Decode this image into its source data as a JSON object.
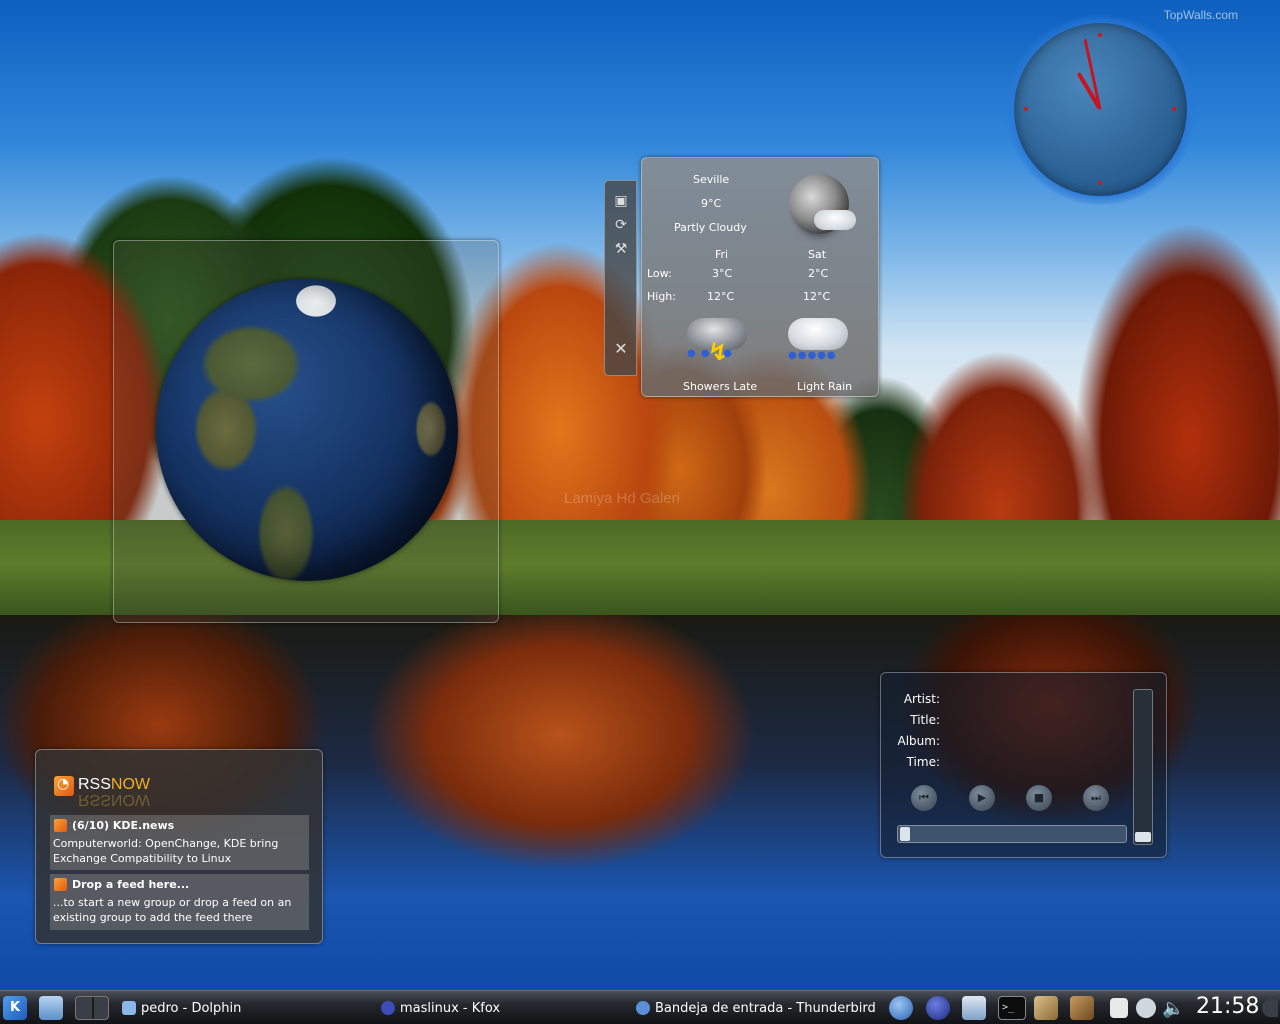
{
  "desktop": {
    "watermark_corner": "TopWalls.com",
    "watermark_center": "Lamiya Hd Galeri"
  },
  "weather": {
    "city": "Seville",
    "temperature": "9°C",
    "condition": "Partly Cloudy",
    "low_label": "Low:",
    "high_label": "High:",
    "days": [
      {
        "name": "Fri",
        "low": "3°C",
        "high": "12°C",
        "forecast": "Showers Late",
        "icon": "thunder-rain-icon"
      },
      {
        "name": "Sat",
        "low": "2°C",
        "high": "12°C",
        "forecast": "Light Rain",
        "icon": "light-rain-icon"
      }
    ],
    "handle_icons": [
      "image-icon",
      "refresh-icon",
      "wrench-icon",
      "close-icon"
    ]
  },
  "clock": {
    "hour": 10,
    "minute": 58
  },
  "rss": {
    "brand_part1": "RSS",
    "brand_part2": "NOW",
    "feeds": [
      {
        "title": "(6/10) KDE.news",
        "text": "Computerworld: OpenChange, KDE bring Exchange Compatibility to Linux"
      },
      {
        "title": "Drop a feed here...",
        "text": "...to start a new group or drop a feed on an existing group to add the feed there"
      }
    ]
  },
  "player": {
    "artist_label": "Artist:",
    "title_label": "Title:",
    "album_label": "Album:",
    "time_label": "Time:",
    "buttons": [
      "previous-icon",
      "play-icon",
      "stop-icon",
      "next-icon"
    ],
    "progress": 0,
    "volume": 0
  },
  "taskbar": {
    "tasks": [
      {
        "label": "pedro - Dolphin",
        "icon": "dolphin-icon"
      },
      {
        "label": "maslinux - Kfox",
        "icon": "kfox-icon"
      },
      {
        "label": "Bandeja de entrada - Thunderbird",
        "icon": "thunderbird-icon"
      }
    ],
    "time": "21:58",
    "colors": {
      "accent": "#2f86d9",
      "rss": "#f0b020",
      "clock_hand": "#c8141e"
    }
  }
}
